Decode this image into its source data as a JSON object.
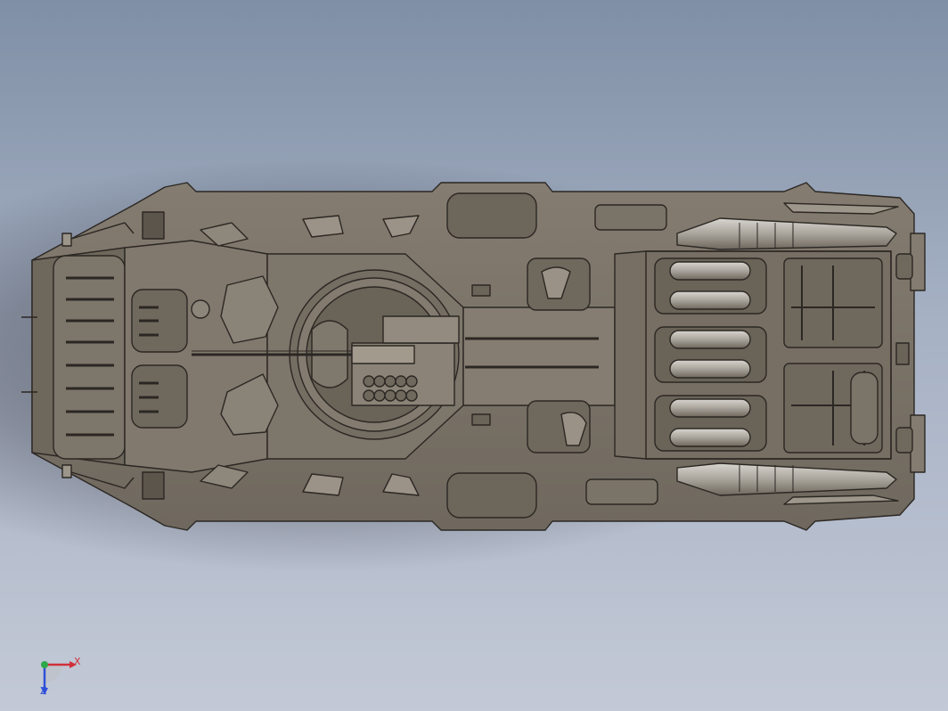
{
  "viewport": {
    "background_top": "#7f8fa5",
    "background_bottom": "#c3c9d6"
  },
  "model": {
    "hull_color": "#7b7368",
    "hull_light": "#8c857a",
    "hull_dark": "#5e574e",
    "outline": "#2b2723"
  },
  "triad": {
    "x_label": "X",
    "z_label": "Z",
    "x_color": "#d0303a",
    "y_color": "#2ea84a",
    "z_color": "#2f4fd8"
  }
}
